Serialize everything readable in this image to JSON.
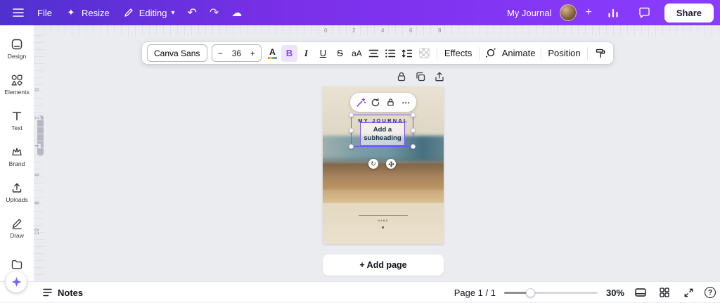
{
  "topbar": {
    "file_label": "File",
    "resize_label": "Resize",
    "editing_label": "Editing",
    "doc_title": "My Journal",
    "share_label": "Share"
  },
  "icons": {
    "resize_sparkle": "✦",
    "chevron_down": "▾",
    "undo": "↶",
    "redo": "↷",
    "cloud": "☁",
    "invite_plus": "+",
    "more": "⋯",
    "rotate": "↻",
    "help": "?"
  },
  "sidebar": {
    "items": [
      {
        "label": "Design"
      },
      {
        "label": "Elements"
      },
      {
        "label": "Text"
      },
      {
        "label": "Brand"
      },
      {
        "label": "Uploads"
      },
      {
        "label": "Draw"
      }
    ]
  },
  "toolbar": {
    "font_name": "Canva Sans",
    "font_size_minus": "−",
    "font_size": "36",
    "font_size_plus": "+",
    "text_color_label": "A",
    "bold_label": "B",
    "italic_label": "I",
    "underline_label": "U",
    "strikethrough_label": "S",
    "case_label": "aA",
    "effects_label": "Effects",
    "animate_label": "Animate",
    "position_label": "Position"
  },
  "rulers": {
    "horizontal": [
      "0",
      "2",
      "4",
      "6",
      "8"
    ],
    "vertical": [
      "0",
      "2",
      "4",
      "6",
      "8",
      "10"
    ]
  },
  "canvas": {
    "title_text": "MY JOURNAL",
    "subheading_text": "Add a subheading",
    "name_label": "NAME"
  },
  "add_page_label": "+ Add page",
  "statusbar": {
    "notes_label": "Notes",
    "page_label": "Page 1 / 1",
    "zoom_label": "30%"
  },
  "colors": {
    "accent": "#8b3dff",
    "selection": "#7c4dff"
  }
}
